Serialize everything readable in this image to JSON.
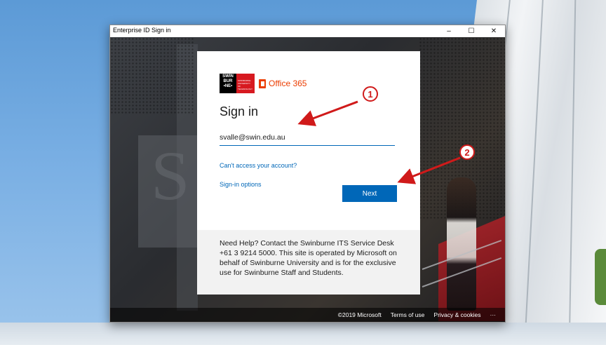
{
  "window": {
    "title": "Enterprise ID Sign in",
    "minimize_glyph": "–",
    "maximize_glyph": "☐",
    "close_glyph": "✕"
  },
  "brand": {
    "university_lines": [
      "SWIN",
      "BUR",
      "•NE•"
    ],
    "university_tagline": "SWINBURNE UNIVERSITY OF TECHNOLOGY",
    "product": "Office 365",
    "accent_color": "#eb3c00",
    "university_color": "#d71920"
  },
  "signin": {
    "heading": "Sign in",
    "email_value": "svalle@swin.edu.au",
    "cant_access_link": "Can't access your account?",
    "signin_options_link": "Sign-in options",
    "next_button": "Next",
    "button_color": "#0067b8"
  },
  "help": {
    "text": "Need Help? Contact the Swinburne ITS Service Desk +61 3 9214 5000. This site is operated by Microsoft on behalf of Swinburne University and is for the exclusive use for Swinburne Staff and Students."
  },
  "footer": {
    "copyright": "©2019 Microsoft",
    "terms": "Terms of use",
    "privacy": "Privacy & cookies",
    "more": "···"
  },
  "annotations": {
    "step1": "1",
    "step2": "2",
    "color": "#d01a1a"
  }
}
